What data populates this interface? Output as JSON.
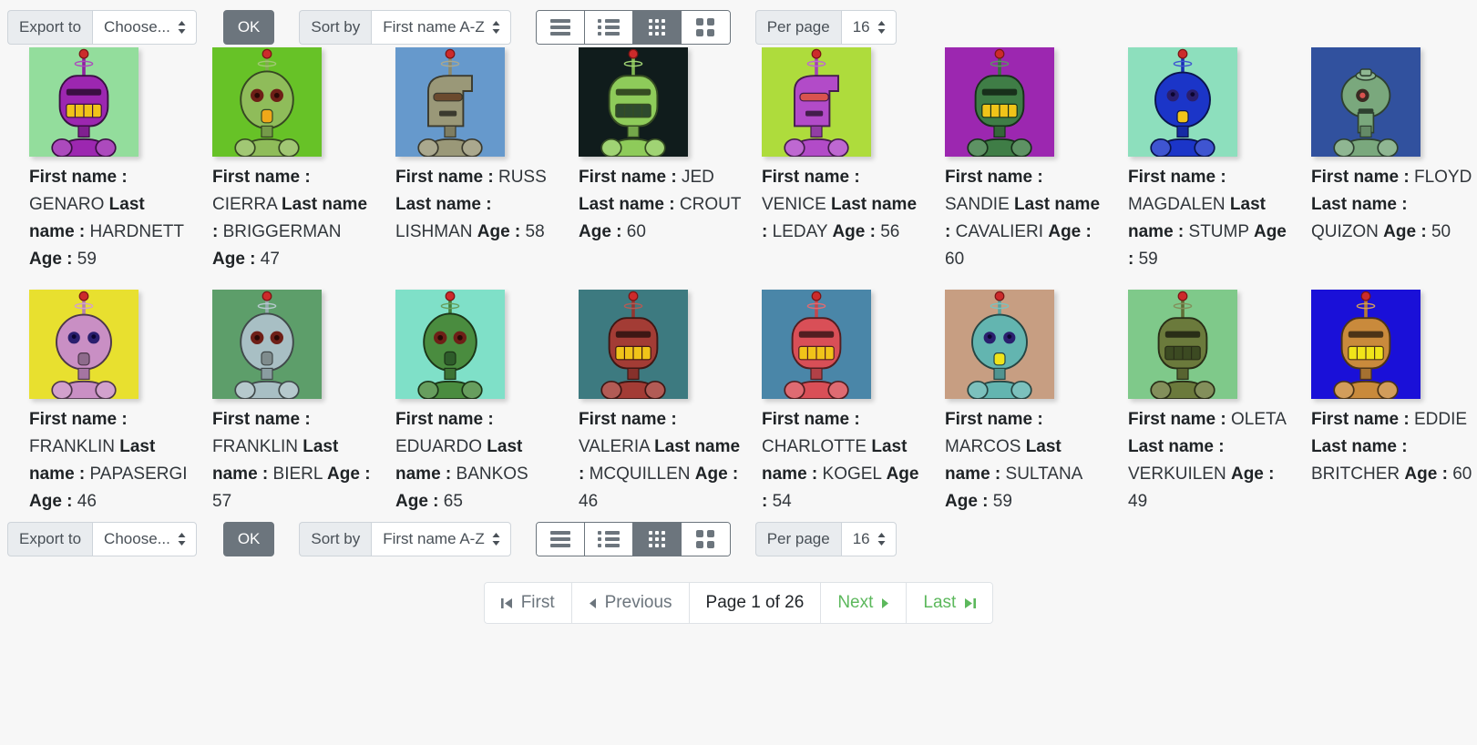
{
  "toolbar": {
    "export_label": "Export to",
    "export_value": "Choose...",
    "ok_label": "OK",
    "sort_label": "Sort by",
    "sort_value": "First name A-Z",
    "perpage_label": "Per page",
    "perpage_value": "16",
    "viewmodes": [
      {
        "name": "view-mode-list",
        "active": false
      },
      {
        "name": "view-mode-detail-list",
        "active": false
      },
      {
        "name": "view-mode-grid-small",
        "active": true
      },
      {
        "name": "view-mode-grid-large",
        "active": false
      }
    ]
  },
  "labels": {
    "first_name": "First name :",
    "last_name": "Last name :",
    "age": "Age :"
  },
  "cards": [
    {
      "first_name": "GENARO",
      "last_name": "HARDNETT",
      "age": "59",
      "bg": "#93dd9c",
      "body": "#9c27b0",
      "head": "boxy",
      "accent": "#f0c419"
    },
    {
      "first_name": "CIERRA",
      "last_name": "BRIGGERMAN",
      "age": "47",
      "bg": "#67c227",
      "body": "#8fbc5a",
      "head": "oval",
      "accent": "#f0a819"
    },
    {
      "first_name": "RUSS",
      "last_name": "LISHMAN",
      "age": "58",
      "bg": "#6699cc",
      "body": "#9a9878",
      "head": "hook",
      "accent": "#6b4a2e"
    },
    {
      "first_name": "JED",
      "last_name": "CROUT",
      "age": "60",
      "bg": "#101c1c",
      "body": "#8ecb5a",
      "head": "boxy",
      "accent": "#2e4a2e"
    },
    {
      "first_name": "VENICE",
      "last_name": "LEDAY",
      "age": "56",
      "bg": "#aedc3c",
      "body": "#b24bc8",
      "head": "hook",
      "accent": "#d9534f"
    },
    {
      "first_name": "SANDIE",
      "last_name": "CAVALIERI",
      "age": "60",
      "bg": "#9c27b0",
      "body": "#3f7d46",
      "head": "boxy",
      "accent": "#f0c419"
    },
    {
      "first_name": "MAGDALEN",
      "last_name": "STUMP",
      "age": "59",
      "bg": "#8ddfbd",
      "body": "#1b35c8",
      "head": "round",
      "accent": "#f0c419"
    },
    {
      "first_name": "FLOYD",
      "last_name": "QUIZON",
      "age": "50",
      "bg": "#31519e",
      "body": "#7aa87d",
      "head": "bulb",
      "accent": "#d9534f"
    },
    {
      "first_name": "FRANKLIN",
      "last_name": "PAPASERGI",
      "age": "46",
      "bg": "#e8e02f",
      "body": "#c98fc4",
      "head": "round",
      "accent": "#8e6b8c"
    },
    {
      "first_name": "FRANKLIN",
      "last_name": "BIERL",
      "age": "57",
      "bg": "#5d9e6a",
      "body": "#a8bfc4",
      "head": "oval",
      "accent": "#7f8c8d"
    },
    {
      "first_name": "EDUARDO",
      "last_name": "BANKOS",
      "age": "65",
      "bg": "#7fe0c8",
      "body": "#4a8c3f",
      "head": "oval",
      "accent": "#2e5c2a"
    },
    {
      "first_name": "VALERIA",
      "last_name": "MCQUILLEN",
      "age": "46",
      "bg": "#3d7a80",
      "body": "#a33c35",
      "head": "boxy",
      "accent": "#f0c419"
    },
    {
      "first_name": "CHARLOTTE",
      "last_name": "KOGEL",
      "age": "54",
      "bg": "#4a86a8",
      "body": "#d94f57",
      "head": "boxy",
      "accent": "#f0c419"
    },
    {
      "first_name": "MARCOS",
      "last_name": "SULTANA",
      "age": "59",
      "bg": "#c79e82",
      "body": "#63b5b0",
      "head": "round",
      "accent": "#f0e419"
    },
    {
      "first_name": "OLETA",
      "last_name": "VERKUILEN",
      "age": "49",
      "bg": "#7fc98a",
      "body": "#6b7a3c",
      "head": "boxy",
      "accent": "#3c4a22"
    },
    {
      "first_name": "EDDIE",
      "last_name": "BRITCHER",
      "age": "60",
      "bg": "#1a10d8",
      "body": "#c98a3c",
      "head": "boxy",
      "accent": "#f0e419"
    }
  ],
  "pagination": {
    "first_label": "First",
    "previous_label": "Previous",
    "page_label": "Page 1 of 26",
    "next_label": "Next",
    "last_label": "Last"
  },
  "colors": {
    "accent_green": "#5cb85c",
    "muted": "#6c757d",
    "page_bg": "#f7f7f7"
  }
}
